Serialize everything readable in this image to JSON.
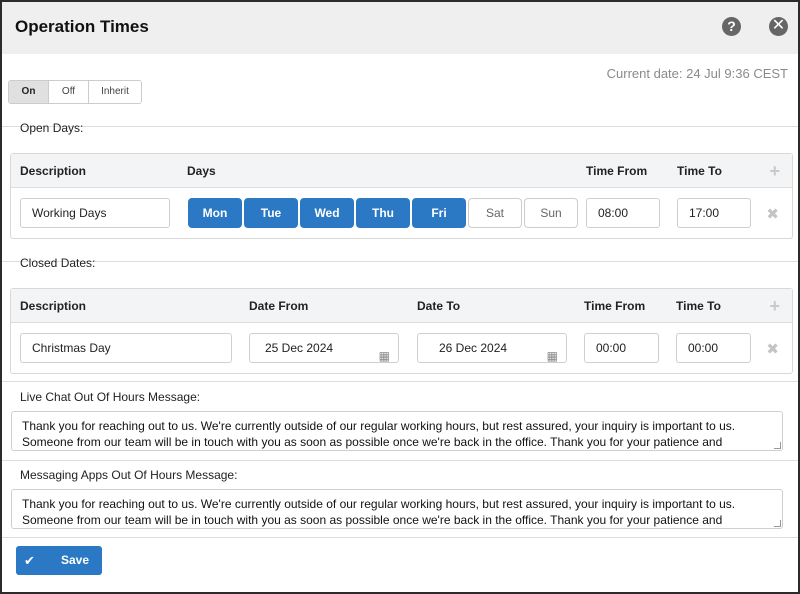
{
  "header": {
    "title": "Operation Times",
    "help_icon": "?",
    "close_icon": "✕"
  },
  "current_date": "Current date: 24 Jul 9:36 CEST",
  "mode_toggle": {
    "options": [
      "On",
      "Off",
      "Inherit"
    ],
    "selected": "On"
  },
  "open_days": {
    "label": "Open Days:",
    "columns": {
      "description": "Description",
      "days": "Days",
      "time_from": "Time From",
      "time_to": "Time To"
    },
    "row": {
      "description": "Working Days",
      "days": [
        {
          "label": "Mon",
          "active": true
        },
        {
          "label": "Tue",
          "active": true
        },
        {
          "label": "Wed",
          "active": true
        },
        {
          "label": "Thu",
          "active": true
        },
        {
          "label": "Fri",
          "active": true
        },
        {
          "label": "Sat",
          "active": false
        },
        {
          "label": "Sun",
          "active": false
        }
      ],
      "time_from": "08:00",
      "time_to": "17:00"
    }
  },
  "closed_dates": {
    "label": "Closed Dates:",
    "columns": {
      "description": "Description",
      "date_from": "Date From",
      "date_to": "Date To",
      "time_from": "Time From",
      "time_to": "Time To"
    },
    "row": {
      "description": "Christmas Day",
      "date_from": "25 Dec 2024",
      "date_to": "26 Dec 2024",
      "time_from": "00:00",
      "time_to": "00:00"
    }
  },
  "live_chat": {
    "label": "Live Chat Out Of Hours Message:",
    "message": "Thank you for reaching out to us. We're currently outside of our regular working hours, but rest assured, your inquiry is important to us. Someone from our team will be in touch with you as soon as possible once we're back in the office. Thank you for your patience and understanding."
  },
  "messaging_apps": {
    "label": "Messaging Apps Out Of Hours Message:",
    "message": "Thank you for reaching out to us. We're currently outside of our regular working hours, but rest assured, your inquiry is important to us. Someone from our team will be in touch with you as soon as possible once we're back in the office. Thank you for your patience and understanding."
  },
  "save_button": {
    "label": "Save",
    "icon": "✔"
  },
  "icons": {
    "plus": "+",
    "delete": "✖",
    "calendar": "▦"
  },
  "colors": {
    "accent": "#2b78c5",
    "header_bg": "#efefef"
  }
}
